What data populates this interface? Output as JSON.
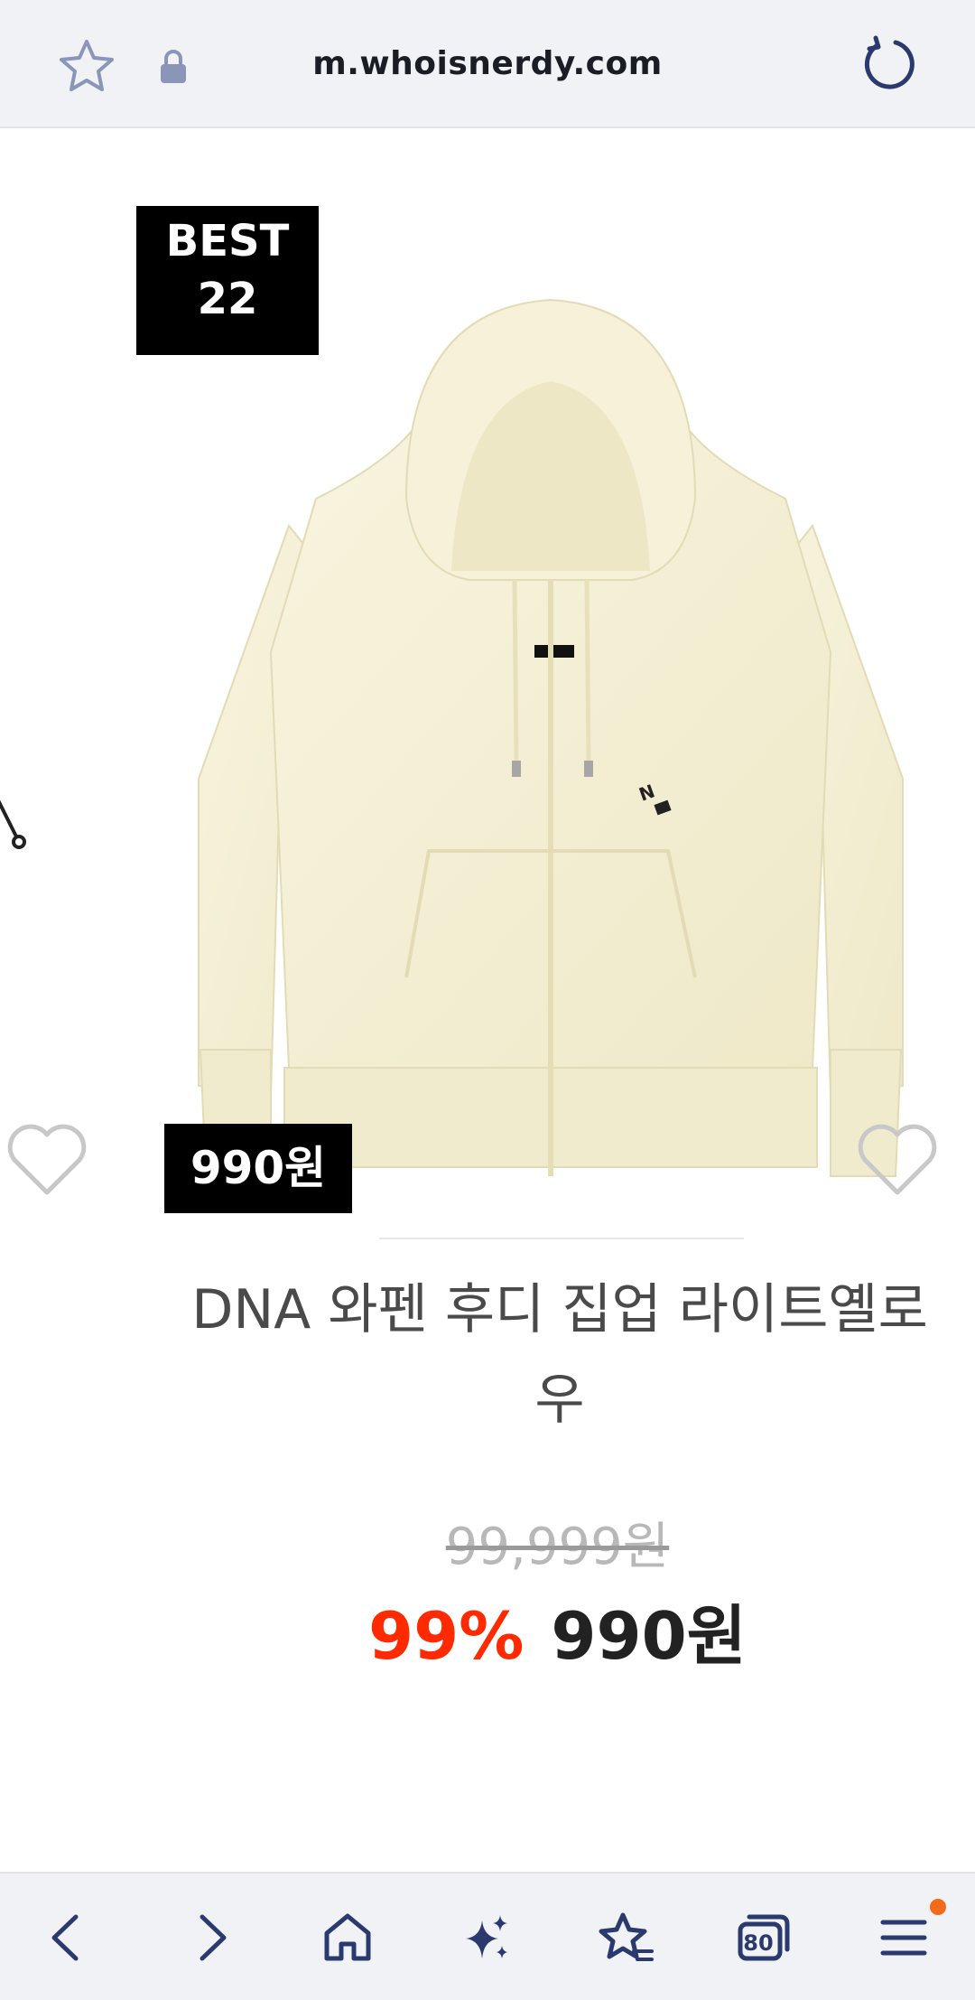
{
  "browser": {
    "url": "m.whoisnerdy.com",
    "icons": {
      "bookmark": "star-icon",
      "secure": "lock-icon",
      "reload": "reload-icon"
    },
    "accent": "#2b3a6e"
  },
  "product": {
    "badge_line1": "BEST",
    "badge_line2": "22",
    "price_badge": "990원",
    "title": "DNA 와펜 후디 집업 라이트옐로우",
    "original_price": "99,999원",
    "discount": "99%",
    "final_price": "990원",
    "colors": {
      "discount": "#ff2a00",
      "hoodie": "#f6f1d6"
    }
  },
  "bottom_nav": {
    "items": [
      "back-icon",
      "forward-icon",
      "home-icon",
      "sparkle-icon",
      "favorites-icon",
      "tabs-icon",
      "menu-icon"
    ],
    "tabs_count": "80",
    "notification_color": "#f26a1b"
  }
}
